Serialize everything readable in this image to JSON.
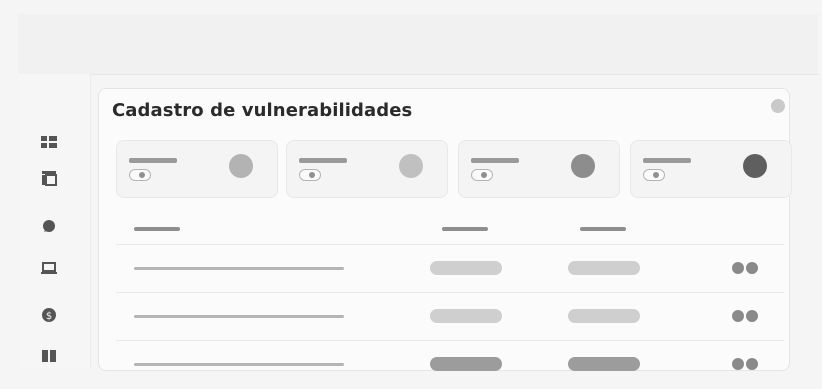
{
  "page": {
    "title": "Cadastro de vulnerabilidades"
  },
  "sidebar": {
    "items": [
      {
        "icon": "grid-icon"
      },
      {
        "icon": "table-icon"
      },
      {
        "icon": "chat-icon"
      },
      {
        "icon": "laptop-icon"
      },
      {
        "icon": "dollar-icon"
      },
      {
        "icon": "book-icon"
      }
    ]
  },
  "summary_cards": [
    {
      "circle_color": "#b3b3b3"
    },
    {
      "circle_color": "#c0c0c0"
    },
    {
      "circle_color": "#8d8d8d"
    },
    {
      "circle_color": "#5f5f5f"
    }
  ],
  "colors": {
    "pill_light": "#cfcfcf",
    "pill_dark": "#9c9c9c",
    "action_dot": "#8a8a8a"
  },
  "table": {
    "row_count": 3
  }
}
